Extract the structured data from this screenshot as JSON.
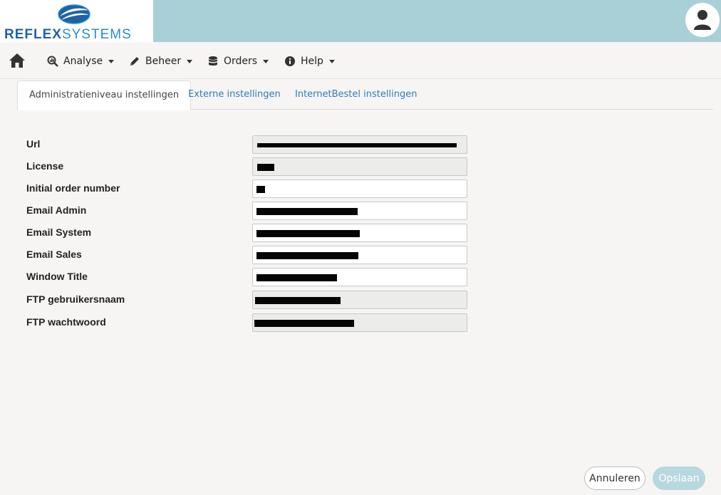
{
  "brand": {
    "logo_part1": "REFLEX",
    "logo_part2": "SYSTEMS",
    "colors": {
      "header_bg": "#a9d0d6",
      "logo_dark": "#1e63a6",
      "logo_light": "#2b8bd0",
      "link": "#2f7bbf"
    }
  },
  "user": {
    "icon": "user-icon"
  },
  "nav": {
    "home_icon": "home-icon",
    "items": [
      {
        "label": "Analyse",
        "icon": "chart-search-icon"
      },
      {
        "label": "Beheer",
        "icon": "pencil-icon"
      },
      {
        "label": "Orders",
        "icon": "database-icon"
      },
      {
        "label": "Help",
        "icon": "info-icon"
      }
    ]
  },
  "tabs": [
    {
      "label": "Administratieniveau instellingen",
      "active": true
    },
    {
      "label": "Externe instellingen",
      "active": false
    },
    {
      "label": "InternetBestel instellingen",
      "active": false
    }
  ],
  "form": {
    "fields": [
      {
        "label": "Url",
        "readonly": true,
        "redacted": true
      },
      {
        "label": "License",
        "readonly": true,
        "redacted": true
      },
      {
        "label": "Initial order number",
        "readonly": false,
        "redacted": true
      },
      {
        "label": "Email Admin",
        "readonly": false,
        "redacted": true
      },
      {
        "label": "Email System",
        "readonly": false,
        "redacted": true
      },
      {
        "label": "Email Sales",
        "readonly": false,
        "redacted": true
      },
      {
        "label": "Window Title",
        "readonly": false,
        "redacted": true
      },
      {
        "label": "FTP gebruikersnaam",
        "readonly": true,
        "redacted": true
      },
      {
        "label": "FTP wachtwoord",
        "readonly": true,
        "redacted": true
      }
    ]
  },
  "buttons": {
    "cancel": "Annuleren",
    "save": "Opslaan"
  }
}
